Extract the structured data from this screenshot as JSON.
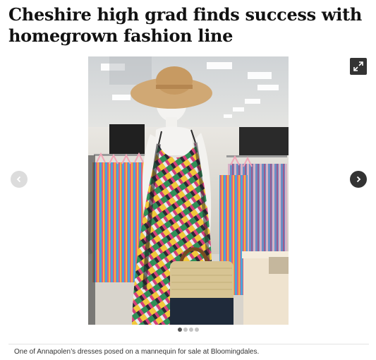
{
  "article": {
    "headline": "Cheshire high grad finds success with homegrown fashion line"
  },
  "gallery": {
    "photo_alt": "Mannequin in a colorful patterned dress and straw hat in a department store",
    "expand_icon": "expand-icon",
    "prev_icon": "chevron-left-icon",
    "next_icon": "chevron-right-icon",
    "slide_count": 4,
    "active_slide": 1,
    "caption": "One of Annapolen’s dresses posed on a mannequin for sale at Bloomingdales."
  },
  "colors": {
    "headline": "#121212",
    "control_dark": "#333333",
    "control_light": "#dcdcdc"
  }
}
